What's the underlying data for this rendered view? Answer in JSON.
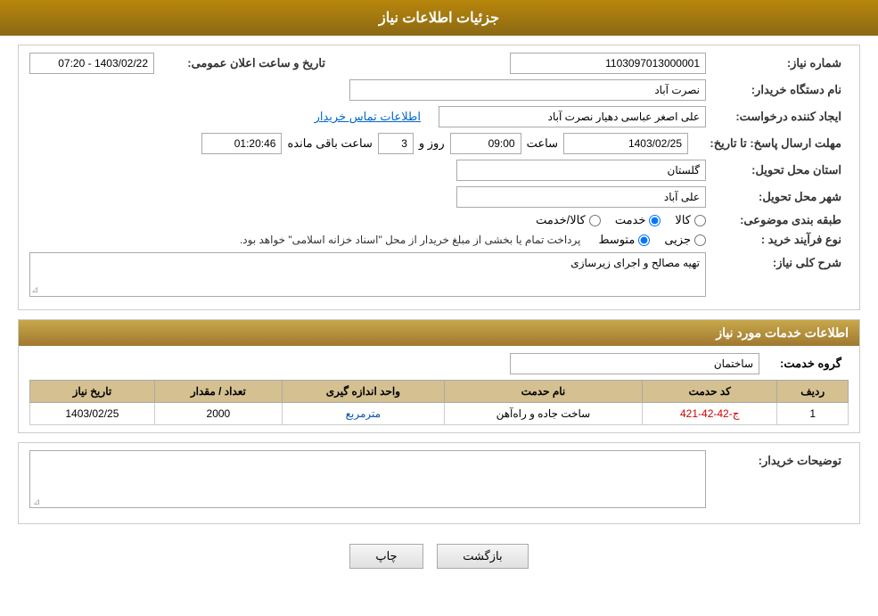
{
  "page": {
    "title": "جزئیات اطلاعات نیاز",
    "sections": {
      "main_info": {
        "need_number_label": "شماره نیاز:",
        "need_number_value": "1103097013000001",
        "announcement_label": "تاریخ و ساعت اعلان عمومی:",
        "announcement_value": "1403/02/22 - 07:20",
        "buyer_name_label": "نام دستگاه خریدار:",
        "buyer_name_value": "نصرت آباد",
        "creator_label": "ایجاد کننده درخواست:",
        "creator_value": "علی اصغر عباسی دهیار نصرت آباد",
        "contact_link": "اطلاعات تماس خریدار",
        "response_deadline_label": "مهلت ارسال پاسخ: تا تاریخ:",
        "response_date_value": "1403/02/25",
        "response_time_label": "ساعت",
        "response_time_value": "09:00",
        "response_days_label": "روز و",
        "response_days_value": "3",
        "response_remaining_label": "ساعت باقی مانده",
        "response_remaining_value": "01:20:46",
        "province_label": "استان محل تحویل:",
        "province_value": "گلستان",
        "city_label": "شهر محل تحویل:",
        "city_value": "علی آباد",
        "category_label": "طبقه بندی موضوعی:",
        "category_options": [
          "کالا",
          "خدمت",
          "کالا/خدمت"
        ],
        "category_selected": "خدمت",
        "purchase_type_label": "نوع فرآیند خرید :",
        "purchase_options": [
          "جزیی",
          "متوسط"
        ],
        "purchase_notice": "پرداخت تمام یا بخشی از مبلغ خریدار از محل \"اسناد خزانه اسلامی\" خواهد بود.",
        "description_label": "شرح کلی نیاز:",
        "description_value": "تهیه مصالح و اجرای زیرسازی"
      },
      "service_info": {
        "header": "اطلاعات خدمات مورد نیاز",
        "service_group_label": "گروه خدمت:",
        "service_group_value": "ساختمان",
        "table": {
          "columns": [
            "ردیف",
            "کد حدمت",
            "نام حدمت",
            "واحد اندازه گیری",
            "تعداد / مقدار",
            "تاریخ نیاز"
          ],
          "rows": [
            {
              "row": "1",
              "code": "ج-42-42-421",
              "name": "ساخت جاده و راه‌آهن",
              "unit": "مترمربع",
              "quantity": "2000",
              "date": "1403/02/25"
            }
          ]
        }
      },
      "buyer_description": {
        "label": "توضیحات خریدار:",
        "value": ""
      }
    },
    "buttons": {
      "print": "چاپ",
      "back": "بازگشت"
    }
  }
}
